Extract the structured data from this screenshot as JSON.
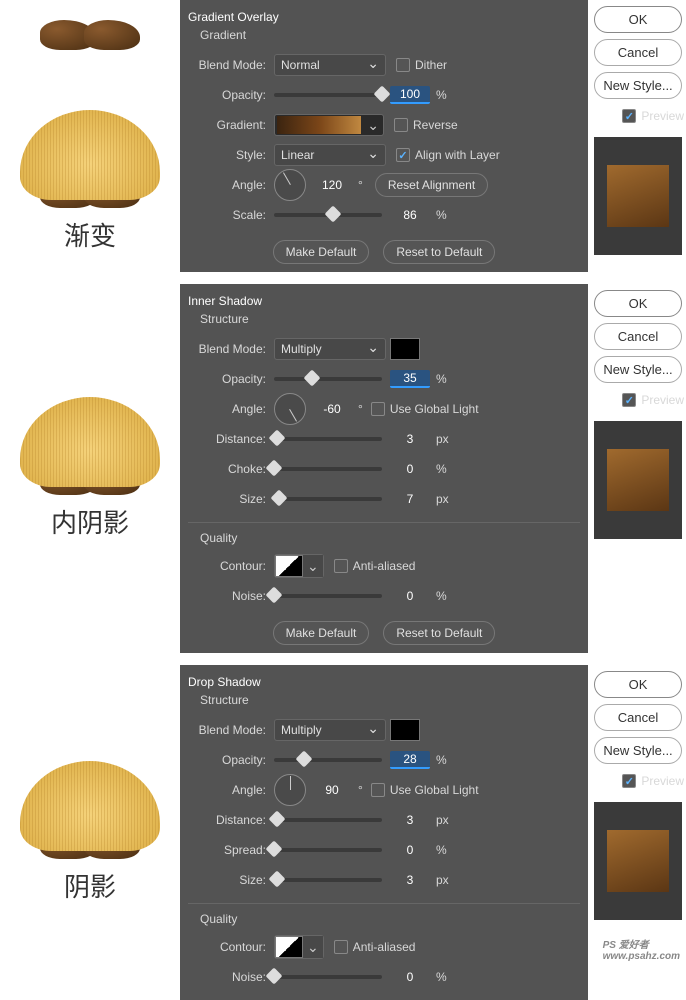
{
  "buttons": {
    "ok": "OK",
    "cancel": "Cancel",
    "new_style": "New Style...",
    "preview": "Preview",
    "reset_align": "Reset Alignment",
    "make_default": "Make Default",
    "reset_default": "Reset to Default"
  },
  "labels": {
    "blend_mode": "Blend Mode:",
    "opacity": "Opacity:",
    "gradient": "Gradient:",
    "style": "Style:",
    "angle": "Angle:",
    "scale": "Scale:",
    "distance": "Distance:",
    "choke": "Choke:",
    "size": "Size:",
    "spread": "Spread:",
    "contour": "Contour:",
    "noise": "Noise:",
    "dither": "Dither",
    "reverse": "Reverse",
    "align": "Align with Layer",
    "use_global": "Use Global Light",
    "anti_aliased": "Anti-aliased",
    "structure": "Structure",
    "quality": "Quality",
    "deg": "°",
    "pct": "%",
    "px": "px"
  },
  "gradient": {
    "title": "Gradient Overlay",
    "sub": "Gradient",
    "blend_mode": "Normal",
    "opacity": "100",
    "style": "Linear",
    "angle": "120",
    "scale": "86",
    "cn": "渐变"
  },
  "inner": {
    "title": "Inner Shadow",
    "blend_mode": "Multiply",
    "opacity": "35",
    "angle": "-60",
    "distance": "3",
    "choke": "0",
    "size": "7",
    "noise": "0",
    "cn": "内阴影"
  },
  "drop": {
    "title": "Drop Shadow",
    "blend_mode": "Multiply",
    "opacity": "28",
    "angle": "90",
    "distance": "3",
    "spread": "0",
    "size": "3",
    "noise": "0",
    "cn": "阴影"
  },
  "watermark": {
    "logo": "PS 爱好者",
    "url": "www.psahz.com"
  }
}
